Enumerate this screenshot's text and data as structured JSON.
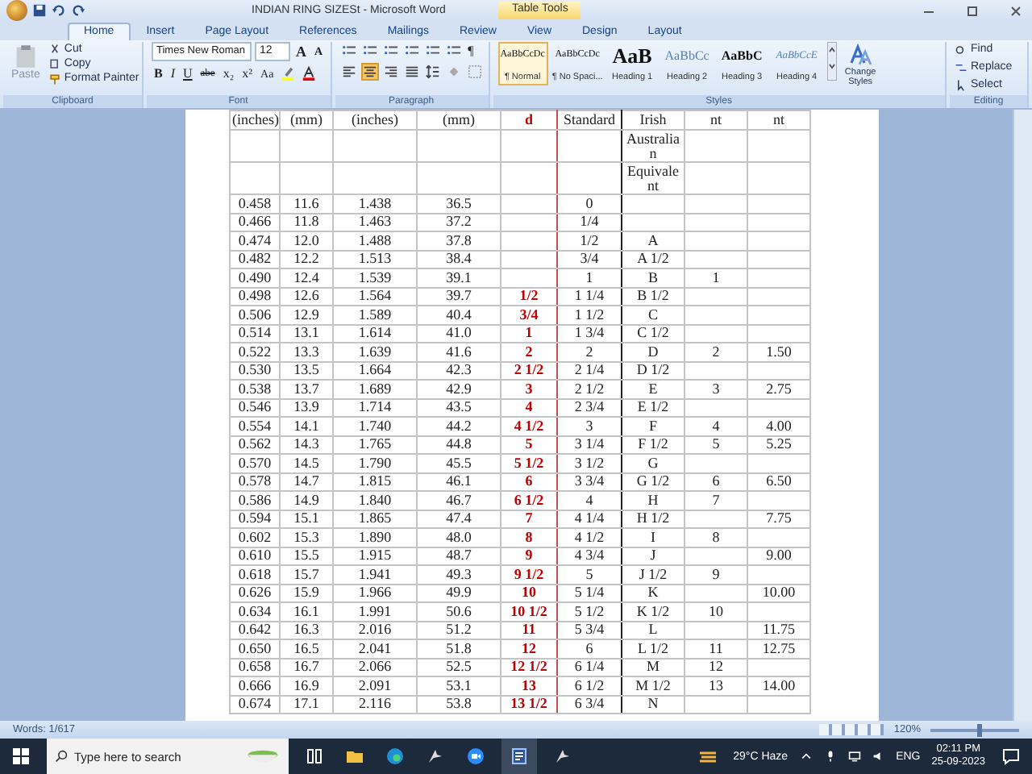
{
  "window": {
    "title": "INDIAN RING SIZESt - Microsoft Word",
    "context_tab": "Table Tools"
  },
  "tabs": [
    {
      "label": "Home",
      "selected": true
    },
    {
      "label": "Insert",
      "selected": false
    },
    {
      "label": "Page Layout",
      "selected": false
    },
    {
      "label": "References",
      "selected": false
    },
    {
      "label": "Mailings",
      "selected": false
    },
    {
      "label": "Review",
      "selected": false
    },
    {
      "label": "View",
      "selected": false
    },
    {
      "label": "Design",
      "selected": false
    },
    {
      "label": "Layout",
      "selected": false
    }
  ],
  "clipboard": {
    "paste": "Paste",
    "items": [
      "Cut",
      "Copy",
      "Format Painter"
    ],
    "label": "Clipboard"
  },
  "font": {
    "name": "Times New Roman",
    "size": "12",
    "size_buttons": [
      "A",
      "A"
    ],
    "format_buttons": [
      "B",
      "I",
      "U",
      "abe",
      "x₂",
      "x²",
      "Aa"
    ],
    "label": "Font"
  },
  "paragraph": {
    "pilcrow": "¶",
    "label": "Paragraph",
    "align": [
      {
        "kind": "left",
        "selected": false
      },
      {
        "kind": "center",
        "selected": true
      },
      {
        "kind": "right",
        "selected": false
      },
      {
        "kind": "justify",
        "selected": false
      }
    ]
  },
  "styles": {
    "items": [
      {
        "sample": "AaBbCcDc",
        "name": "¶ Normal",
        "selected": true,
        "kind": "body"
      },
      {
        "sample": "AaBbCcDc",
        "name": "¶ No Spaci...",
        "selected": false,
        "kind": "body"
      },
      {
        "sample": "AaB",
        "name": "Heading 1",
        "selected": false,
        "kind": "h1"
      },
      {
        "sample": "AaBbCc",
        "name": "Heading 2",
        "selected": false,
        "kind": "h2"
      },
      {
        "sample": "AaBbC",
        "name": "Heading 3",
        "selected": false,
        "kind": "h3"
      },
      {
        "sample": "AaBbCcE",
        "name": "Heading 4",
        "selected": false,
        "kind": "h4"
      }
    ],
    "change": "Change Styles",
    "label": "Styles"
  },
  "editing": {
    "items": [
      "Find",
      "Replace",
      "Select"
    ],
    "label": "Editing"
  },
  "table": {
    "header_rows": [
      [
        "(inches)",
        "(mm)",
        "(inches)",
        "(mm)",
        "d",
        "Standard",
        "Irish",
        "nt",
        "nt"
      ],
      [
        null,
        null,
        null,
        null,
        null,
        null,
        "Australian",
        null,
        null
      ],
      [
        null,
        null,
        null,
        null,
        null,
        null,
        "Equivalent",
        null,
        null
      ]
    ],
    "rows": [
      [
        "0.458",
        "11.6",
        "1.438",
        "36.5",
        null,
        "0",
        null,
        null,
        null
      ],
      [
        "0.466",
        "11.8",
        "1.463",
        "37.2",
        null,
        "1/4",
        null,
        null,
        null
      ],
      [
        "0.474",
        "12.0",
        "1.488",
        "37.8",
        null,
        "1/2",
        "A",
        null,
        null
      ],
      [
        "0.482",
        "12.2",
        "1.513",
        "38.4",
        null,
        "3/4",
        "A 1/2",
        null,
        null
      ],
      [
        "0.490",
        "12.4",
        "1.539",
        "39.1",
        null,
        "1",
        "B",
        "1",
        null
      ],
      [
        "0.498",
        "12.6",
        "1.564",
        "39.7",
        "1/2",
        "1 1/4",
        "B 1/2",
        null,
        null
      ],
      [
        "0.506",
        "12.9",
        "1.589",
        "40.4",
        "3/4",
        "1 1/2",
        "C",
        null,
        null
      ],
      [
        "0.514",
        "13.1",
        "1.614",
        "41.0",
        "1",
        "1 3/4",
        "C 1/2",
        null,
        null
      ],
      [
        "0.522",
        "13.3",
        "1.639",
        "41.6",
        "2",
        "2",
        "D",
        "2",
        "1.50"
      ],
      [
        "0.530",
        "13.5",
        "1.664",
        "42.3",
        "2 1/2",
        "2 1/4",
        "D 1/2",
        null,
        null
      ],
      [
        "0.538",
        "13.7",
        "1.689",
        "42.9",
        "3",
        "2 1/2",
        "E",
        "3",
        "2.75"
      ],
      [
        "0.546",
        "13.9",
        "1.714",
        "43.5",
        "4",
        "2 3/4",
        "E 1/2",
        null,
        null
      ],
      [
        "0.554",
        "14.1",
        "1.740",
        "44.2",
        "4 1/2",
        "3",
        "F",
        "4",
        "4.00"
      ],
      [
        "0.562",
        "14.3",
        "1.765",
        "44.8",
        "5",
        "3 1/4",
        "F 1/2",
        "5",
        "5.25"
      ],
      [
        "0.570",
        "14.5",
        "1.790",
        "45.5",
        "5 1/2",
        "3 1/2",
        "G",
        null,
        null
      ],
      [
        "0.578",
        "14.7",
        "1.815",
        "46.1",
        "6",
        "3 3/4",
        "G 1/2",
        "6",
        "6.50"
      ],
      [
        "0.586",
        "14.9",
        "1.840",
        "46.7",
        "6 1/2",
        "4",
        "H",
        "7",
        null
      ],
      [
        "0.594",
        "15.1",
        "1.865",
        "47.4",
        "7",
        "4 1/4",
        "H 1/2",
        null,
        "7.75"
      ],
      [
        "0.602",
        "15.3",
        "1.890",
        "48.0",
        "8",
        "4 1/2",
        "I",
        "8",
        null
      ],
      [
        "0.610",
        "15.5",
        "1.915",
        "48.7",
        "9",
        "4 3/4",
        "J",
        null,
        "9.00"
      ],
      [
        "0.618",
        "15.7",
        "1.941",
        "49.3",
        "9 1/2",
        "5",
        "J 1/2",
        "9",
        null
      ],
      [
        "0.626",
        "15.9",
        "1.966",
        "49.9",
        "10",
        "5 1/4",
        "K",
        null,
        "10.00"
      ],
      [
        "0.634",
        "16.1",
        "1.991",
        "50.6",
        "10 1/2",
        "5 1/2",
        "K 1/2",
        "10",
        null
      ],
      [
        "0.642",
        "16.3",
        "2.016",
        "51.2",
        "11",
        "5 3/4",
        "L",
        null,
        "11.75"
      ],
      [
        "0.650",
        "16.5",
        "2.041",
        "51.8",
        "12",
        "6",
        "L 1/2",
        "11",
        "12.75"
      ],
      [
        "0.658",
        "16.7",
        "2.066",
        "52.5",
        "12 1/2",
        "6 1/4",
        "M",
        "12",
        null
      ],
      [
        "0.666",
        "16.9",
        "2.091",
        "53.1",
        "13",
        "6 1/2",
        "M 1/2",
        "13",
        "14.00"
      ],
      [
        "0.674",
        "17.1",
        "2.116",
        "53.8",
        "13 1/2",
        "6 3/4",
        "N",
        null,
        null
      ]
    ]
  },
  "status_bar": {
    "words": "Words: 1/617",
    "zoom": "120%",
    "zoom_slider": {
      "level": 0.55
    }
  },
  "taskbar": {
    "search_placeholder": "Type here to search",
    "weather": "29°C Haze",
    "language": "ENG",
    "time": "02:11 PM",
    "date": "25-09-2023"
  }
}
